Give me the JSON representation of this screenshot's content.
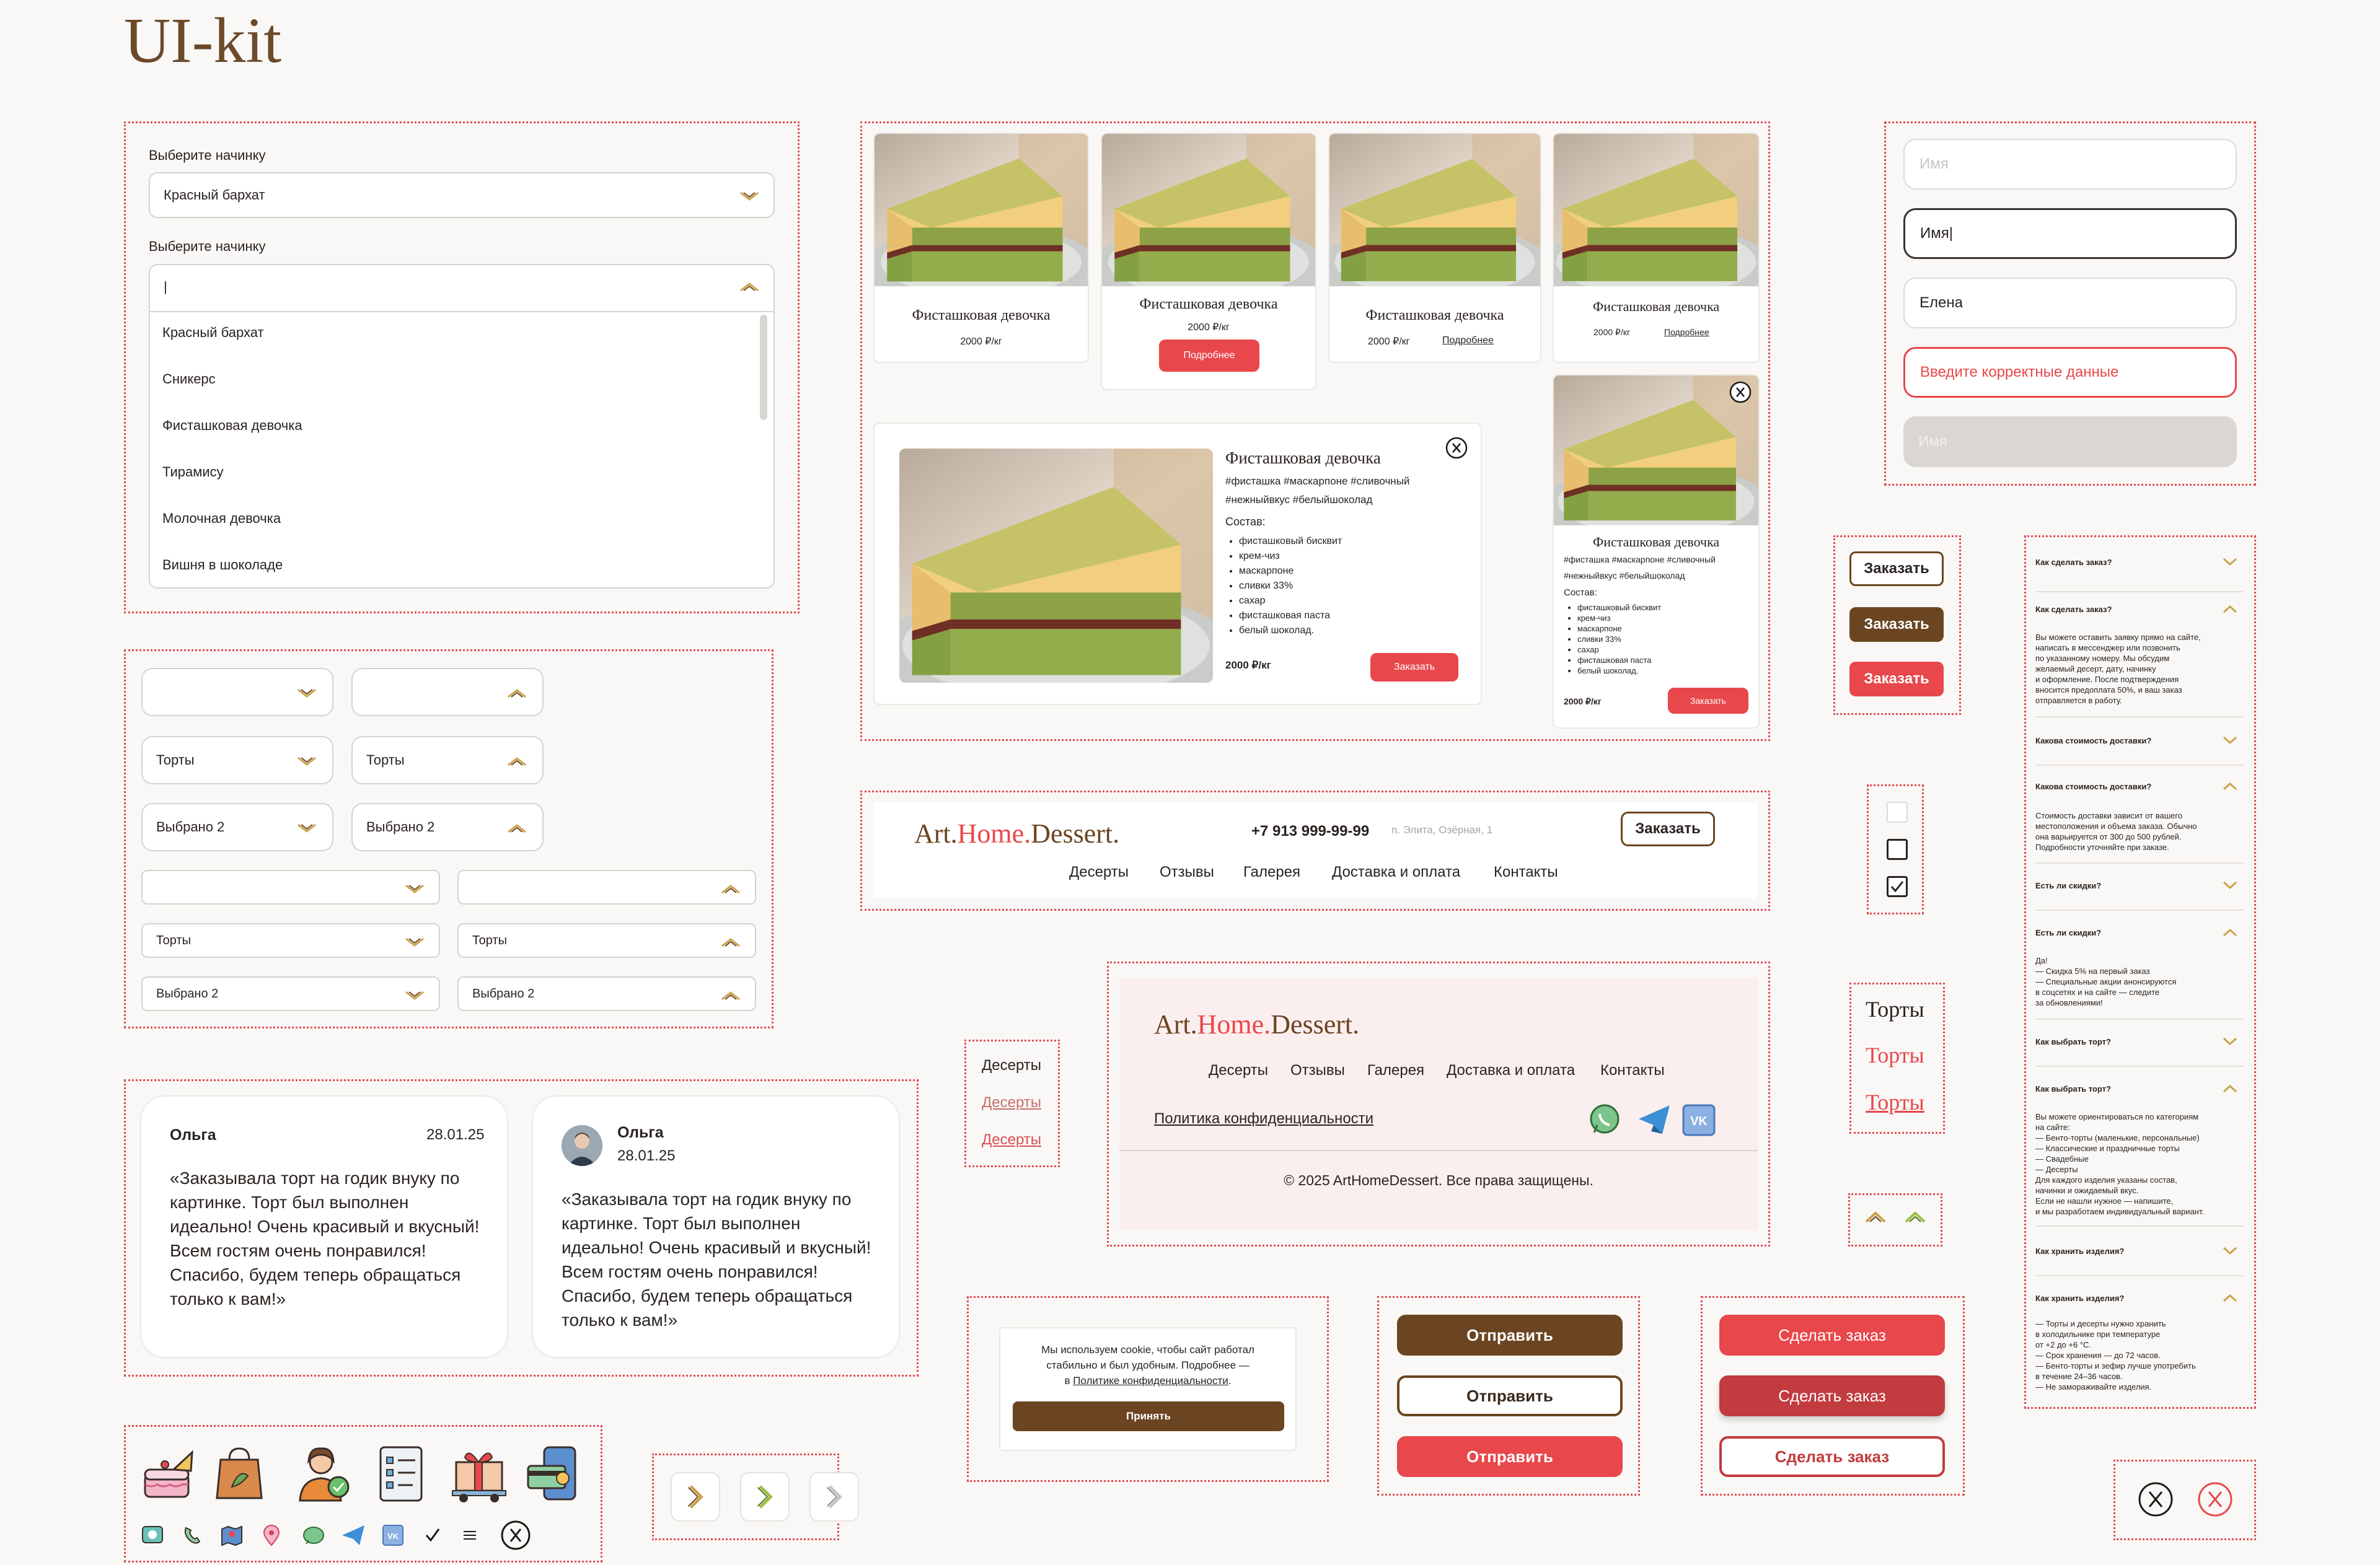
{
  "kit_title": "UI-kit",
  "select_panel": {
    "label1": "Выберите начинку",
    "value1": "Красный бархат",
    "label2": "Выберите начинку",
    "value2": "|",
    "options": [
      "Красный бархат",
      "Сникерс",
      "Фисташковая девочка",
      "Тирамису",
      "Молочная девочка",
      "Вишня в шоколаде"
    ]
  },
  "dropdowns": {
    "torty": "Торты",
    "selected": "Выбрано 2"
  },
  "cards": {
    "title": "Фисташковая девочка",
    "price": "2000 ₽/кг",
    "more": "Подробнее",
    "order": "Заказать",
    "price_bold": "2000 ₽/кг",
    "tags_line1": "#фисташка #маскарпоне #сливочный",
    "tags_line2": "#нежныйвкус #белыйшоколад",
    "composition": "Состав:",
    "ingredients": [
      "фисташковый бисквит",
      "крем-чиз",
      "маскарпоне",
      "сливки 33%",
      "сахар",
      "фисташковая паста",
      "белый шоколад."
    ]
  },
  "header": {
    "logo_a": "Art.",
    "logo_b": "Home.",
    "logo_c": "Dessert.",
    "phone": "+7 913 999-99-99",
    "address": "п. Элита, Озёрная, 1",
    "order": "Заказать",
    "nav": [
      "Десерты",
      "Отзывы",
      "Галерея",
      "Доставка и оплата",
      "Контакты"
    ]
  },
  "footer": {
    "policy": "Политика конфиденциальности",
    "copyright": "© 2025 ArtHomeDessert. Все права защищены."
  },
  "link_states": [
    "Десерты",
    "Десерты",
    "Десерты"
  ],
  "reviews": [
    {
      "name": "Ольга",
      "date": "28.01.25",
      "text": "«Заказывала торт на годик внуку по картинке. Торт был выполнен идеально! Очень красивый и вкусный! Всем гостям очень понравился! Спасибо, будем теперь обращаться только к вам!»"
    },
    {
      "name": "Ольга",
      "date": "28.01.25",
      "text": "«Заказывала торт на годик внуку по картинке. Торт был выполнен идеально! Очень красивый и вкусный! Всем гостям очень понравился! Спасибо, будем теперь обращаться только к вам!»"
    }
  ],
  "cookie": {
    "text1": "Мы используем cookie, чтобы сайт работал",
    "text2": "стабильно и был удобным. Подробнее —",
    "text3a": "в ",
    "text3b": "Политике конфиденциальности",
    "text3c": ".",
    "accept": "Принять"
  },
  "buttons": {
    "send": "Отправить",
    "make_order": "Сделать заказ",
    "order": "Заказать"
  },
  "inputs": {
    "placeholder": "Имя",
    "typing": "Имя",
    "filled": "Елена",
    "error": "Введите корректные данные",
    "disabled": "Имя"
  },
  "text_states": [
    "Торты",
    "Торты",
    "Торты"
  ],
  "faq": {
    "q1": "Как сделать заказ?",
    "a1": [
      "Вы можете оставить заявку прямо на сайте,",
      "написать в мессенджер или позвонить",
      "по указанному номеру. Мы обсудим",
      "желаемый десерт, дату, начинку",
      "и оформление. После подтверждения",
      "вносится предоплата 50%, и ваш заказ",
      "отправляется в работу."
    ],
    "q2": "Какова стоимость доставки?",
    "a2": [
      "Стоимость доставки зависит от вашего",
      "местоположения и объема заказа. Обычно",
      "она варьируется от 300 до 500 рублей.",
      "Подробности уточняйте при заказе."
    ],
    "q3": "Есть ли скидки?",
    "a3": [
      "Да!",
      "— Скидка 5% на первый заказ",
      "— Специальные акции анонсируются",
      "в соцсетях и на сайте — следите",
      "за обновлениями!"
    ],
    "q4": "Как выбрать торт?",
    "a4": [
      "Вы можете ориентироваться по категориям",
      "на сайте:",
      "— Бенто-торты (маленькие, персональные)",
      "— Классические и праздничные торты",
      "— Свадебные",
      "— Десерты",
      "Для каждого изделия указаны состав,",
      "начинки и ожидаемый вкус.",
      "Если не нашли нужное — напишите,",
      "и мы разработаем индивидуальный вариант."
    ],
    "q5": "Как хранить изделия?",
    "a5": [
      "— Торты и десерты нужно хранить",
      "в холодильнике при температуре",
      "от +2 до +6 °C.",
      "— Срок хранения — до 72 часов.",
      "— Бенто-торты и зефир лучше употребить",
      "в течение 24–36 часов.",
      "— Не замораживайте изделия."
    ]
  },
  "colors": {
    "brown": "#6b4521",
    "red": "#e8474b",
    "dark_red": "#c13b3f",
    "accent_gold": "#c9a24a",
    "bg": "#f9f8f6"
  },
  "icon_names": [
    "cake-icon",
    "bag-icon",
    "manager-icon",
    "checklist-icon",
    "delivery-icon",
    "payment-icon",
    "whatsapp-icon",
    "phone-icon",
    "map-icon",
    "location-icon",
    "chat-icon",
    "telegram-icon",
    "vk-icon",
    "check-icon",
    "menu-icon",
    "close-icon"
  ]
}
